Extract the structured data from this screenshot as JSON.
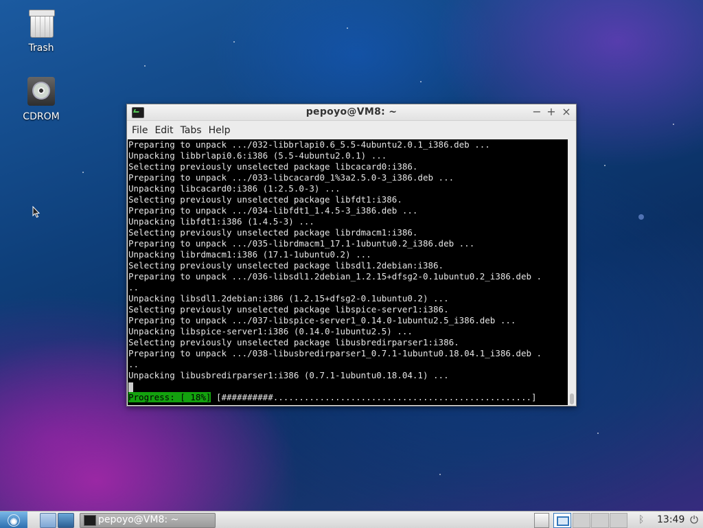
{
  "desktop": {
    "icons": [
      {
        "label": "Trash",
        "icon": "trash-icon"
      },
      {
        "label": "CDROM",
        "icon": "cdrom-icon"
      }
    ]
  },
  "window": {
    "title": "pepoyo@VM8: ~",
    "controls": {
      "minimize": "−",
      "maximize": "+",
      "close": "×"
    },
    "menu": [
      "File",
      "Edit",
      "Tabs",
      "Help"
    ]
  },
  "terminal": {
    "lines": [
      "Preparing to unpack .../032-libbrlapi0.6_5.5-4ubuntu2.0.1_i386.deb ...",
      "Unpacking libbrlapi0.6:i386 (5.5-4ubuntu2.0.1) ...",
      "Selecting previously unselected package libcacard0:i386.",
      "Preparing to unpack .../033-libcacard0_1%3a2.5.0-3_i386.deb ...",
      "Unpacking libcacard0:i386 (1:2.5.0-3) ...",
      "Selecting previously unselected package libfdt1:i386.",
      "Preparing to unpack .../034-libfdt1_1.4.5-3_i386.deb ...",
      "Unpacking libfdt1:i386 (1.4.5-3) ...",
      "Selecting previously unselected package librdmacm1:i386.",
      "Preparing to unpack .../035-librdmacm1_17.1-1ubuntu0.2_i386.deb ...",
      "Unpacking librdmacm1:i386 (17.1-1ubuntu0.2) ...",
      "Selecting previously unselected package libsdl1.2debian:i386.",
      "Preparing to unpack .../036-libsdl1.2debian_1.2.15+dfsg2-0.1ubuntu0.2_i386.deb .",
      "..",
      "Unpacking libsdl1.2debian:i386 (1.2.15+dfsg2-0.1ubuntu0.2) ...",
      "Selecting previously unselected package libspice-server1:i386.",
      "Preparing to unpack .../037-libspice-server1_0.14.0-1ubuntu2.5_i386.deb ...",
      "Unpacking libspice-server1:i386 (0.14.0-1ubuntu2.5) ...",
      "Selecting previously unselected package libusbredirparser1:i386.",
      "Preparing to unpack .../038-libusbredirparser1_0.7.1-1ubuntu0.18.04.1_i386.deb .",
      "..",
      "Unpacking libusbredirparser1:i386 (0.7.1-1ubuntu0.18.04.1) ..."
    ],
    "progress_label": "Progress: [ 18%]",
    "progress_bar": " [##########..................................................]",
    "progress_fraction": 0.18,
    "progress_color": "#13a10e"
  },
  "taskbar": {
    "task_label": "pepoyo@VM8: ~",
    "clock": "13:49",
    "icons": [
      "start-menu-icon",
      "file-manager-icon",
      "preferences-icon",
      "terminal-icon",
      "window-list-icon",
      "bluetooth-icon",
      "power-icon"
    ]
  }
}
